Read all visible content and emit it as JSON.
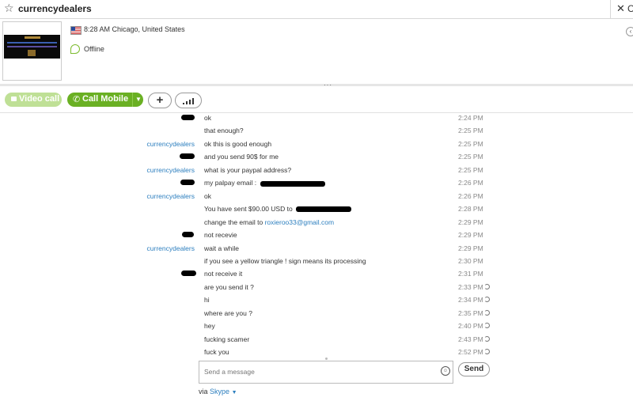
{
  "window": {
    "title": "currencydealers",
    "close_glyph": "✕",
    "extra_tab_glyph": "C"
  },
  "profile": {
    "location": "8:28 AM Chicago, United States",
    "status": "Offline",
    "status_color": "#7cbb2e"
  },
  "toolbar": {
    "video_call": "Video call",
    "call_mobile": "Call Mobile",
    "add": "+",
    "accent": "#6ab023"
  },
  "messages": [
    {
      "sender": "",
      "scribble": true,
      "text": "ok",
      "time": "2:24 PM"
    },
    {
      "sender": "",
      "scribble": false,
      "text": "that enough?",
      "time": "2:25 PM"
    },
    {
      "sender": "currencydealers",
      "scribble": false,
      "text": "ok this is good enough",
      "time": "2:25 PM"
    },
    {
      "sender": "",
      "scribble": true,
      "text": "and you send 90$ for me",
      "time": "2:25 PM"
    },
    {
      "sender": "currencydealers",
      "scribble": false,
      "text": "what is your paypal address?",
      "time": "2:25 PM"
    },
    {
      "sender": "",
      "scribble": true,
      "text": "my palpay email : ",
      "time": "2:26 PM",
      "redacted": true
    },
    {
      "sender": "currencydealers",
      "scribble": false,
      "text": "ok",
      "time": "2:26 PM"
    },
    {
      "sender": "",
      "scribble": false,
      "text": "You have sent $90.00 USD to ",
      "time": "2:28 PM",
      "redacted": true
    },
    {
      "sender": "",
      "scribble": false,
      "text": "change the email to ",
      "link": "roxieroo33@gmail.com",
      "time": "2:29 PM"
    },
    {
      "sender": "",
      "scribble": true,
      "text": "not recevie",
      "time": "2:29 PM"
    },
    {
      "sender": "currencydealers",
      "scribble": false,
      "text": "wait a while",
      "time": "2:29 PM"
    },
    {
      "sender": "",
      "scribble": false,
      "text": "if you see a yellow triangle ! sign means its processing",
      "time": "2:30 PM"
    },
    {
      "sender": "",
      "scribble": true,
      "text": "not receive it",
      "time": "2:31 PM"
    },
    {
      "sender": "",
      "scribble": false,
      "text": "are you send it ?",
      "time": "2:33 PM",
      "pending": true
    },
    {
      "sender": "",
      "scribble": false,
      "text": "hi",
      "time": "2:34 PM",
      "pending": true
    },
    {
      "sender": "",
      "scribble": false,
      "text": "where are you ?",
      "time": "2:35 PM",
      "pending": true
    },
    {
      "sender": "",
      "scribble": false,
      "text": "hey",
      "time": "2:40 PM",
      "pending": true
    },
    {
      "sender": "",
      "scribble": false,
      "text": "fucking scamer",
      "time": "2:43 PM",
      "pending": true
    },
    {
      "sender": "",
      "scribble": false,
      "text": "fuck you",
      "time": "2:52 PM",
      "pending": true
    }
  ],
  "composer": {
    "placeholder": "Send a message",
    "send_label": "Send",
    "via_label": "via",
    "via_service": "Skype"
  }
}
